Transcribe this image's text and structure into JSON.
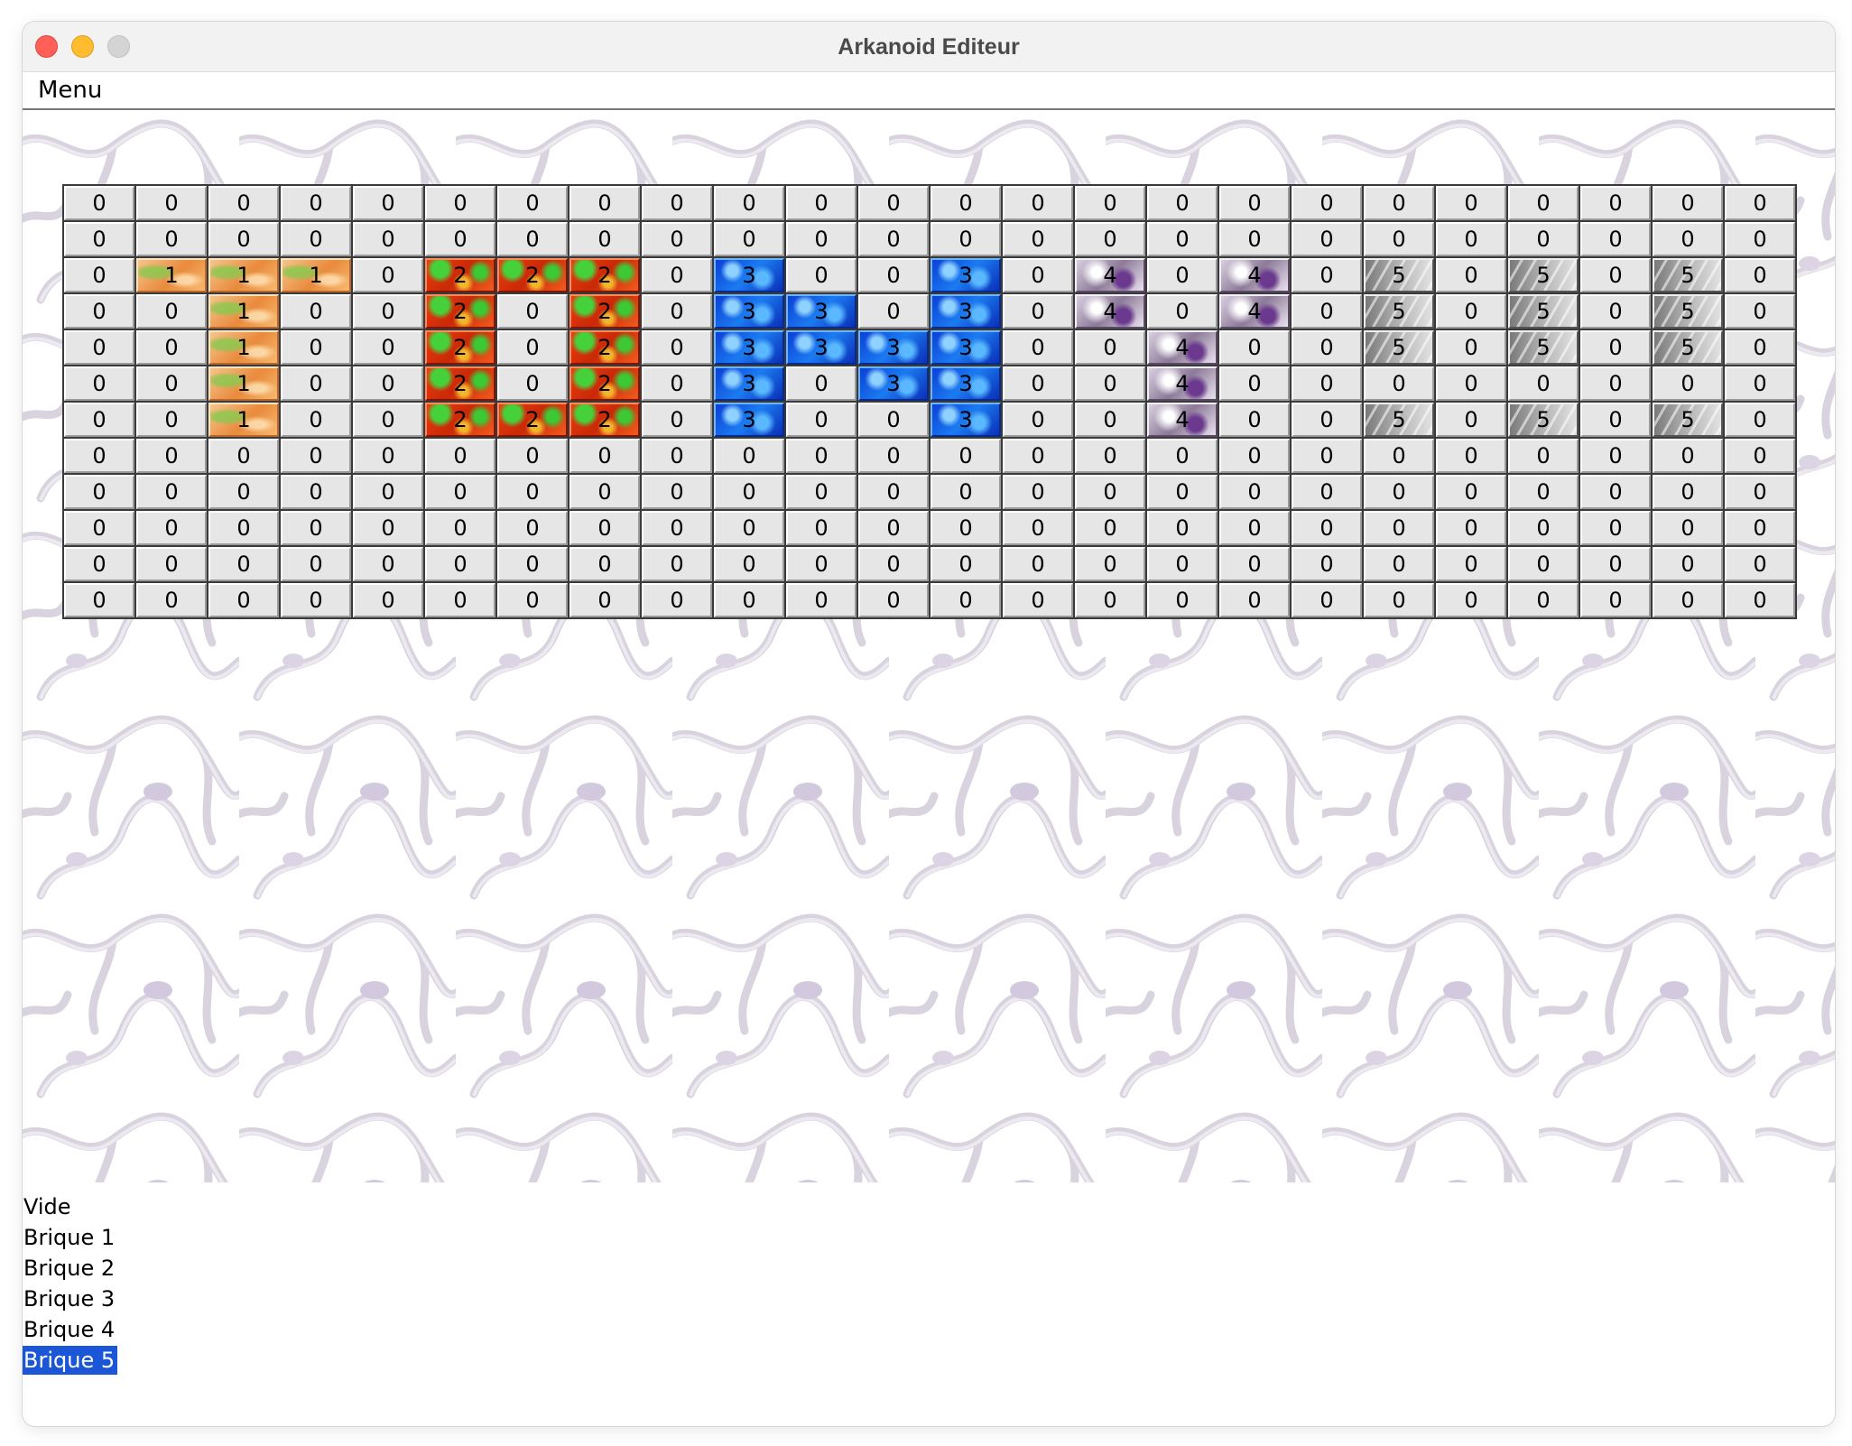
{
  "window": {
    "title": "Arkanoid Editeur"
  },
  "menubar": {
    "items": [
      {
        "label": "Menu"
      }
    ]
  },
  "grid": {
    "rows": [
      [
        0,
        0,
        0,
        0,
        0,
        0,
        0,
        0,
        0,
        0,
        0,
        0,
        0,
        0,
        0,
        0,
        0,
        0,
        0,
        0,
        0,
        0,
        0,
        0
      ],
      [
        0,
        0,
        0,
        0,
        0,
        0,
        0,
        0,
        0,
        0,
        0,
        0,
        0,
        0,
        0,
        0,
        0,
        0,
        0,
        0,
        0,
        0,
        0,
        0
      ],
      [
        0,
        1,
        1,
        1,
        0,
        2,
        2,
        2,
        0,
        3,
        0,
        0,
        3,
        0,
        4,
        0,
        4,
        0,
        5,
        0,
        5,
        0,
        5,
        0
      ],
      [
        0,
        0,
        1,
        0,
        0,
        2,
        0,
        2,
        0,
        3,
        3,
        0,
        3,
        0,
        4,
        0,
        4,
        0,
        5,
        0,
        5,
        0,
        5,
        0
      ],
      [
        0,
        0,
        1,
        0,
        0,
        2,
        0,
        2,
        0,
        3,
        3,
        3,
        3,
        0,
        0,
        4,
        0,
        0,
        5,
        0,
        5,
        0,
        5,
        0
      ],
      [
        0,
        0,
        1,
        0,
        0,
        2,
        0,
        2,
        0,
        3,
        0,
        3,
        3,
        0,
        0,
        4,
        0,
        0,
        0,
        0,
        0,
        0,
        0,
        0
      ],
      [
        0,
        0,
        1,
        0,
        0,
        2,
        2,
        2,
        0,
        3,
        0,
        0,
        3,
        0,
        0,
        4,
        0,
        0,
        5,
        0,
        5,
        0,
        5,
        0
      ],
      [
        0,
        0,
        0,
        0,
        0,
        0,
        0,
        0,
        0,
        0,
        0,
        0,
        0,
        0,
        0,
        0,
        0,
        0,
        0,
        0,
        0,
        0,
        0,
        0
      ],
      [
        0,
        0,
        0,
        0,
        0,
        0,
        0,
        0,
        0,
        0,
        0,
        0,
        0,
        0,
        0,
        0,
        0,
        0,
        0,
        0,
        0,
        0,
        0,
        0
      ],
      [
        0,
        0,
        0,
        0,
        0,
        0,
        0,
        0,
        0,
        0,
        0,
        0,
        0,
        0,
        0,
        0,
        0,
        0,
        0,
        0,
        0,
        0,
        0,
        0
      ],
      [
        0,
        0,
        0,
        0,
        0,
        0,
        0,
        0,
        0,
        0,
        0,
        0,
        0,
        0,
        0,
        0,
        0,
        0,
        0,
        0,
        0,
        0,
        0,
        0
      ],
      [
        0,
        0,
        0,
        0,
        0,
        0,
        0,
        0,
        0,
        0,
        0,
        0,
        0,
        0,
        0,
        0,
        0,
        0,
        0,
        0,
        0,
        0,
        0,
        0
      ]
    ]
  },
  "palette": {
    "items": [
      {
        "label": "Vide",
        "selected": false
      },
      {
        "label": "Brique 1",
        "selected": false
      },
      {
        "label": "Brique 2",
        "selected": false
      },
      {
        "label": "Brique 3",
        "selected": false
      },
      {
        "label": "Brique 4",
        "selected": false
      },
      {
        "label": "Brique 5",
        "selected": true
      }
    ],
    "selection_color": "#1a56d6"
  },
  "colors": {
    "brick1": "#e98a3c",
    "brick2": "#c92907",
    "brick3": "#1c7bf0",
    "brick4": "#8c7a98",
    "brick5": "#b9b9b9"
  }
}
